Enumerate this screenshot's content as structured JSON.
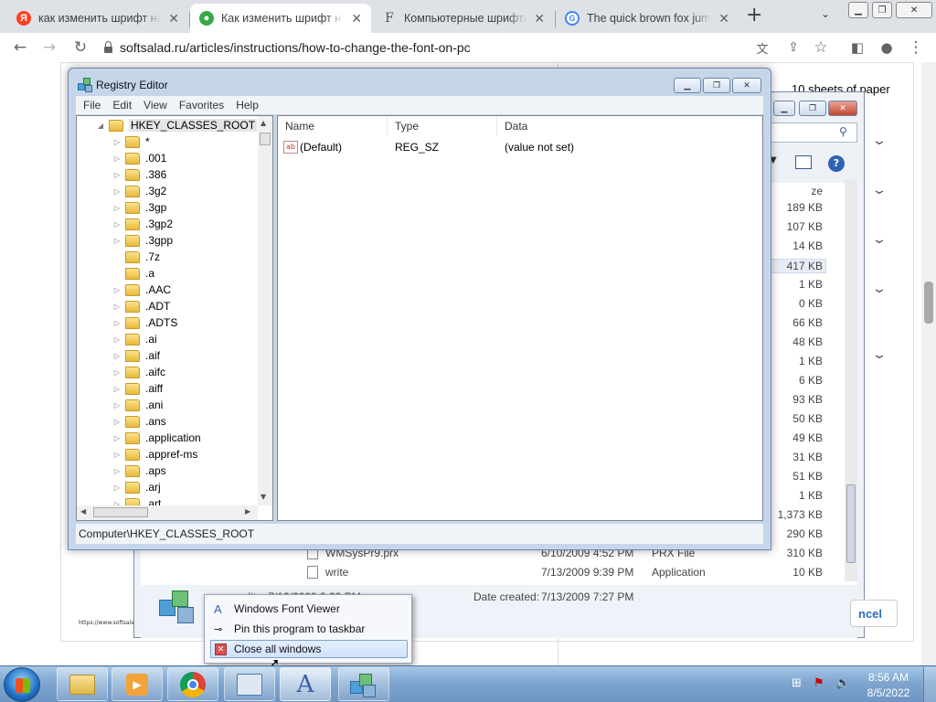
{
  "browser": {
    "tabs": [
      {
        "title": "как изменить шрифт на",
        "icon": "yandex-icon"
      },
      {
        "title": "Как изменить шрифт на",
        "icon": "softsalad-icon"
      },
      {
        "title": "Компьютерные шрифты",
        "icon": "font-f-icon"
      },
      {
        "title": "The quick brown fox jump",
        "icon": "google-icon"
      }
    ],
    "url": "softsalad.ru/articles/instructions/how-to-change-the-font-on-pc"
  },
  "page": {
    "heading_fragment": "10 sheets of paper",
    "watermark": "https://www.softsalad..."
  },
  "explorer": {
    "cancel_label": "ncel",
    "sizes": [
      "ze",
      "189 KB",
      "107 KB",
      "14 KB",
      "417 KB",
      "1 KB",
      "0 KB",
      "66 KB",
      "48 KB",
      "1 KB",
      "6 KB",
      "93 KB",
      "50 KB",
      "49 KB",
      "31 KB",
      "51 KB",
      "1 KB",
      "1,373 KB",
      "290 KB",
      "310 KB",
      "10 KB"
    ],
    "files": [
      {
        "name": "WMSysPr9.prx",
        "date": "6/10/2009 4:52 PM",
        "type": "PRX File",
        "size": "310 KB"
      },
      {
        "name": "write",
        "date": "7/13/2009 9:39 PM",
        "type": "Application",
        "size": "10 KB"
      }
    ],
    "details": {
      "modified_fragment": "...:lit...  7/13/2009 9:39 PM",
      "created_label": "Date created:",
      "created_value": "7/13/2009 7:27 PM"
    }
  },
  "registry": {
    "title": "Registry Editor",
    "menu": [
      "File",
      "Edit",
      "View",
      "Favorites",
      "Help"
    ],
    "root": "HKEY_CLASSES_ROOT",
    "keys": [
      "*",
      ".001",
      ".386",
      ".3g2",
      ".3gp",
      ".3gp2",
      ".3gpp",
      ".7z",
      ".a",
      ".AAC",
      ".ADT",
      ".ADTS",
      ".ai",
      ".aif",
      ".aifc",
      ".aiff",
      ".ani",
      ".ans",
      ".application",
      ".appref-ms",
      ".aps",
      ".arj",
      ".art"
    ],
    "columns": [
      "Name",
      "Type",
      "Data"
    ],
    "values": [
      {
        "name": "(Default)",
        "type": "REG_SZ",
        "data": "(value not set)"
      }
    ],
    "status": "Computer\\HKEY_CLASSES_ROOT"
  },
  "jumplist": {
    "items": [
      "Windows Font Viewer",
      "Pin this program to taskbar",
      "Close all windows"
    ]
  },
  "taskbar": {
    "time": "8:56 AM",
    "date": "8/5/2022",
    "apps": [
      "explorer-icon",
      "media-player-icon",
      "chrome-icon",
      "control-panel-icon",
      "font-viewer-icon",
      "registry-editor-icon"
    ]
  },
  "colors": {
    "taskbar": "#7fa6d0",
    "chrome_tabstrip": "#dee1e6",
    "registry_frame": "#c6d6ea",
    "highlight": "#cfe2fb"
  }
}
